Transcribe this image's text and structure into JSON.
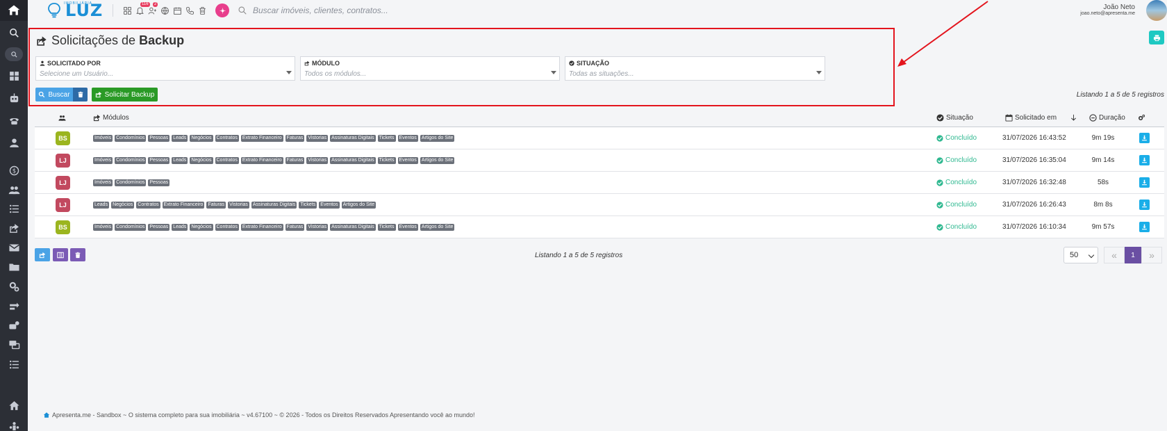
{
  "header": {
    "logo_small": "IMOBILIÁRIA",
    "logo_text": "LUZ",
    "badges": {
      "notifications": "116",
      "users": "2"
    },
    "search_placeholder": "Buscar imóveis, clientes, contratos...",
    "user_name": "João Neto",
    "user_email": "joao.neto@apresenta.me"
  },
  "page": {
    "title_light": "Solicitações de",
    "title_bold": "Backup"
  },
  "filters": [
    {
      "label": "SOLICITADO POR",
      "placeholder": "Selecione um Usuário...",
      "icon": "user-icon"
    },
    {
      "label": "MÓDULO",
      "placeholder": "Todos os módulos...",
      "icon": "share-icon"
    },
    {
      "label": "SITUAÇÃO",
      "placeholder": "Todas as situações...",
      "icon": "check-circle-icon"
    }
  ],
  "buttons": {
    "buscar": "Buscar",
    "solicitar": "Solicitar Backup"
  },
  "count_text": "Listando 1 a 5 de 5 registros",
  "table": {
    "headers": {
      "modulos": "Módulos",
      "situacao": "Situação",
      "solicitado_em": "Solicitado em",
      "duracao": "Duração"
    },
    "rows": [
      {
        "initials": "BS",
        "color": "#9bb51f",
        "modules": [
          "Imóveis",
          "Condomínios",
          "Pessoas",
          "Leads",
          "Negócios",
          "Contratos",
          "Extrato Financeiro",
          "Faturas",
          "Vistorias",
          "Assinaturas Digitais",
          "Tickets",
          "Eventos",
          "Artigos do Site"
        ],
        "status": "Concluído",
        "date": "31/07/2026 16:43:52",
        "duration": "9m 19s"
      },
      {
        "initials": "LJ",
        "color": "#c2495f",
        "modules": [
          "Imóveis",
          "Condomínios",
          "Pessoas",
          "Leads",
          "Negócios",
          "Contratos",
          "Extrato Financeiro",
          "Faturas",
          "Vistorias",
          "Assinaturas Digitais",
          "Tickets",
          "Eventos",
          "Artigos do Site"
        ],
        "status": "Concluído",
        "date": "31/07/2026 16:35:04",
        "duration": "9m 14s"
      },
      {
        "initials": "LJ",
        "color": "#c2495f",
        "modules": [
          "Imóveis",
          "Condomínios",
          "Pessoas"
        ],
        "status": "Concluído",
        "date": "31/07/2026 16:32:48",
        "duration": "58s"
      },
      {
        "initials": "LJ",
        "color": "#c2495f",
        "modules": [
          "Leads",
          "Negócios",
          "Contratos",
          "Extrato Financeiro",
          "Faturas",
          "Vistorias",
          "Assinaturas Digitais",
          "Tickets",
          "Eventos",
          "Artigos do Site"
        ],
        "status": "Concluído",
        "date": "31/07/2026 16:26:43",
        "duration": "8m 8s"
      },
      {
        "initials": "BS",
        "color": "#9bb51f",
        "modules": [
          "Imóveis",
          "Condomínios",
          "Pessoas",
          "Leads",
          "Negócios",
          "Contratos",
          "Extrato Financeiro",
          "Faturas",
          "Vistorias",
          "Assinaturas Digitais",
          "Tickets",
          "Eventos",
          "Artigos do Site"
        ],
        "status": "Concluído",
        "date": "31/07/2026 16:10:34",
        "duration": "9m 57s"
      }
    ]
  },
  "pagination": {
    "per_page": "50",
    "current": "1"
  },
  "footer": "Apresenta.me - Sandbox ~ O sistema completo para sua imobiliária ~ v4.67100 ~ © 2026 - Todos os Direitos Reservados Apresentando você ao mundo!",
  "colors": {
    "accent": "#4aa3e6",
    "success": "#2fb890",
    "green_button": "#2a9a26",
    "highlight": "#e3141d"
  }
}
